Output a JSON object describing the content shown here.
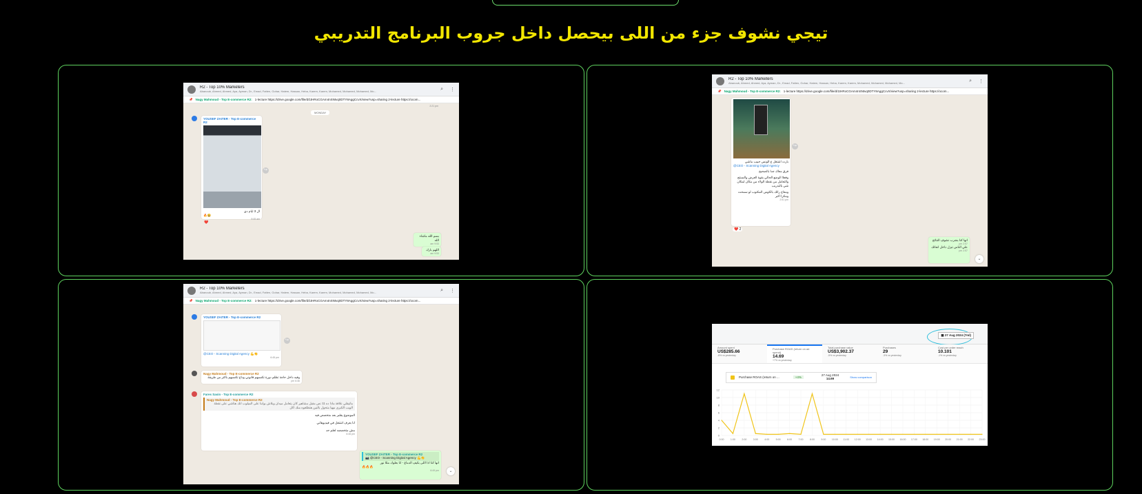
{
  "heading": "تيجي نشوف جزء من اللى بيحصل داخل جروب البرنامج التدريبي",
  "whatsapp": {
    "group_name": "R2 - Top 10% Marketers",
    "members": "Abanoub, Ahmed, Ahmed, Aya, Ayman, Dr., Emad, Fatten, Gohar, Hatem, Hassan, Heba, Karem, Karem, Mohamed, Mohamed, Mohamed, Mo...",
    "pinned_sender": "Nagy Mahmoud - Top E-commerce R2:",
    "pinned_text": "1-lecture https://drive.google.com/file/d/1tHRoCGAm4nSNtvq0DTY8AggCcvX/view?usp=sharing 2-lecture https://ocom...",
    "search_icon": "search-icon",
    "menu_icon": "more-vertical-icon"
  },
  "shot1": {
    "top_time": "2:21 pm",
    "date_label": "MONDAY",
    "sender": "YOUSEF ZAITER - Top E-commerce R2",
    "caption": "ال 3 ايام دي",
    "emoji": "🔥😀",
    "time1": "9:45 am",
    "reaction": "❤️",
    "out1": "بسم الله ماشاء الله",
    "out1_time": "9:53 am",
    "out2": "اللهم بارك",
    "out2_time": "9:53 am"
  },
  "shot2": {
    "mention": "@CEO - Scanning Digital Agency",
    "l1": "بارت اشتغل ع الونس حبيب ماشي",
    "l2": "فرق معاك جدا بالصحيح",
    "l3": "وفعلا الوضع الحالي بقوة العرض والسنتج والتعامل من نقطة الولاء من مكان لمكان شي بالتدريب",
    "l4": "ومعاج رائك بالكوس المكتوب لو سمحت ومكرا اكبر",
    "time": "2:51 pm",
    "reaction": "❤️ 2",
    "out1": "انها كنا بنجرب نشوف النتائج",
    "out1_time": "2:57 pm",
    "out2": "علي الناس تيزل داخل انفاتك",
    "out2_time": "2:57 pm"
  },
  "shot3": {
    "sender1": "YOUSEF ZAITER - Top E-commerce R2",
    "mention": "@CEO - Scanning Digital Agency",
    "emoji1": "💪👏",
    "time1": "6:45 pm",
    "sender2": "Nagy Mahmoud - Top E-commerce R2",
    "msg2": "وفيه داخل حاجة تظلم دورة تكسبهم قانوني وداع تكسبهم باكتر من طريقة",
    "time2": "6:46 pm",
    "sender3": "Fares Sasin - Top E-commerce R2",
    "quote_sender": "Nagy Mahmoud - Top E-commerce R2",
    "quote_text": "ماتيقلي علاقة ماذا ده 11 نص مقبل مشاهير كان يتعامل ميدان وبلاش بوابنا على الميلوب انك هتاشي على نقطة الويب الكبرى مهيا متحول بالنين هتطلعوه منك اكل",
    "m3a": "الموضوع يقلبر بعد متخصص فيه",
    "m3b": "انا بعرف اشتغل في فيديوهاتي",
    "m3c": "مش متخصصه لعلم حد",
    "time3": "6:46 pm",
    "reply_sender": "YOUSEF ZAITER - Top E-commerce R2",
    "reply_quote": "📷 @CEO - Scanning Digital Agency 💪👏",
    "out": "انها كنا اذا اللى بكيف الدماغ - انا بعلوك مثلا نور",
    "fire": "🔥🔥🔥",
    "out_time": "6:49 pm"
  },
  "dashboard": {
    "date_button": "27 Aug 2024 (7ml)",
    "metrics": [
      {
        "label": "Amount spent",
        "value": "US$285.66",
        "delta": "-8% vs yesterday"
      },
      {
        "label": "Purchase ROAS (return on ad spend)",
        "value": "14.69",
        "delta": "+7% vs yesterday"
      },
      {
        "label": "Total purchase value",
        "value": "US$3,902.37",
        "delta": "-5% vs yesterday"
      },
      {
        "label": "Purchases",
        "value": "29",
        "delta": "-3% vs yesterday"
      },
      {
        "label": "Cost per order reach",
        "value": "10.101",
        "delta": "-1% vs yesterday"
      }
    ],
    "legend_label": "Purchase ROAS (return on ...",
    "legend_badge": "+4%",
    "tip_date": "27 Aug 2024",
    "tip_value": "14.69",
    "compare_link": "Show comparison",
    "x_ticks": [
      "0:00",
      "1:00",
      "2:00",
      "3:00",
      "4:00",
      "5:00",
      "6:00",
      "7:00",
      "8:00",
      "9:00",
      "10:00",
      "11:00",
      "12:00",
      "13:00",
      "14:00",
      "15:00",
      "16:00",
      "17:00",
      "18:00",
      "19:00",
      "20:00",
      "21:00",
      "22:00",
      "23:00"
    ],
    "y_ticks": [
      "0",
      "2",
      "4",
      "6",
      "8",
      "10",
      "12"
    ]
  },
  "chart_data": {
    "type": "line",
    "x": [
      "0:00",
      "1:00",
      "2:00",
      "3:00",
      "4:00",
      "5:00",
      "6:00",
      "7:00",
      "8:00",
      "9:00",
      "10:00",
      "11:00",
      "12:00",
      "13:00",
      "14:00",
      "15:00",
      "16:00",
      "17:00",
      "18:00",
      "19:00",
      "20:00",
      "21:00",
      "22:00",
      "23:00"
    ],
    "series": [
      {
        "name": "Purchase ROAS (return on ...",
        "values": [
          4,
          0.5,
          11,
          0.5,
          0.3,
          0.3,
          0.5,
          0.3,
          11,
          0.3,
          0.3,
          0.3,
          0.3,
          0.3,
          0.3,
          0.3,
          0.3,
          0.3,
          0.3,
          0.3,
          0.3,
          0.3,
          0.3,
          0.3
        ]
      }
    ],
    "ylim": [
      0,
      12
    ],
    "grid": true,
    "color": "#f0c419"
  }
}
